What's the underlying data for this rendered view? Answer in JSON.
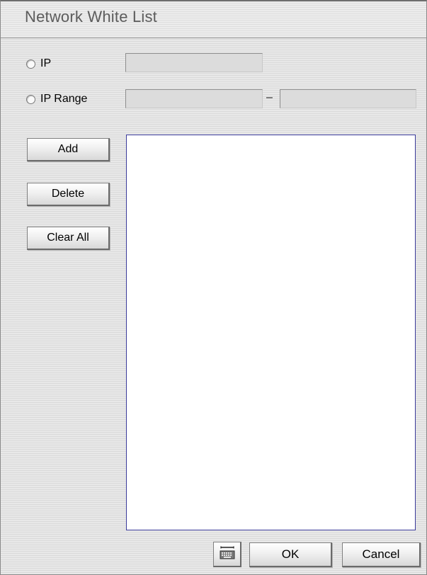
{
  "dialog": {
    "title": "Network White List"
  },
  "options": {
    "ip_label": "IP",
    "ip_range_label": "IP Range",
    "range_separator": "–",
    "ip_value": "",
    "range_start_value": "",
    "range_end_value": ""
  },
  "actions": {
    "add_label": "Add",
    "delete_label": "Delete",
    "clear_all_label": "Clear All"
  },
  "whitelist": {
    "entries": []
  },
  "footer": {
    "keyboard_icon": "virtual-keyboard-icon",
    "ok_label": "OK",
    "cancel_label": "Cancel"
  },
  "colors": {
    "list_border": "#3a3a9a",
    "title_text": "#5c5c5c"
  }
}
